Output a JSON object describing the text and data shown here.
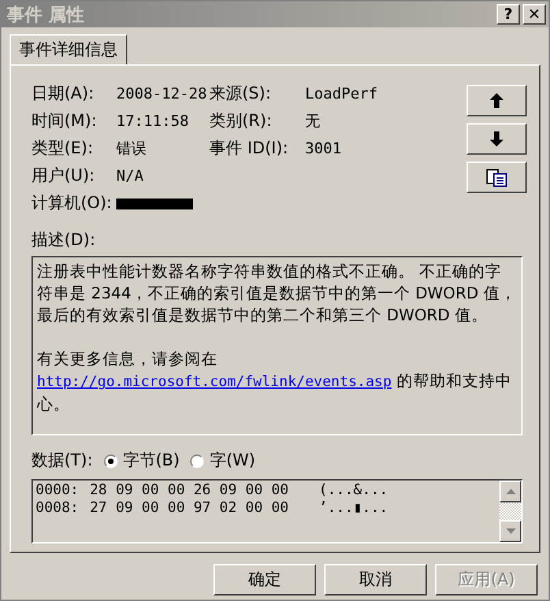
{
  "window": {
    "title": "事件 属性",
    "title_buttons": [
      "?",
      "✕"
    ]
  },
  "tabs": [
    {
      "label": "事件详细信息",
      "selected": true
    }
  ],
  "fields": [
    {
      "label": "日期(A):",
      "value": "2008-12-28",
      "label2": "来源(S):",
      "value2": "LoadPerf"
    },
    {
      "label": "时间(M):",
      "value": "17:11:58",
      "label2": "类别(R):",
      "value2": "无"
    },
    {
      "label": "类型(E):",
      "value": "错误",
      "label2": "事件 ID(I):",
      "value2": "3001"
    },
    {
      "label": "用户(U):",
      "value": "N/A"
    },
    {
      "label": "计算机(O):",
      "kind": "redacted"
    }
  ],
  "side_buttons": [
    {
      "kind": "up"
    },
    {
      "kind": "down"
    },
    {
      "kind": "copy"
    }
  ],
  "description": {
    "label": "描述(D):",
    "text": "注册表中性能计数器名称字符串数值的格式不正确。 不正确的字符串是 2344，不正确的索引值是数据节中的第一个 DWORD 值，最后的有效索引值是数据节中的第二个和第三个 DWORD 值。",
    "more_info": "有关更多信息，请参阅在",
    "link": "http://go.microsoft.com/fwlink/events.asp",
    "link_after": "的帮助和支持中心。"
  },
  "data": {
    "label": "数据(T):",
    "radios": [
      {
        "label": "字节(B)",
        "selected": true
      },
      {
        "label": "字(W)",
        "selected": false
      }
    ],
    "rows": [
      {
        "offset": "0000:",
        "bytes": "28 09 00 00 26 09 00 00",
        "ascii": "(...&..."
      },
      {
        "offset": "0008:",
        "bytes": "27 09 00 00 97 02 00 00",
        "ascii": "’...▮..."
      }
    ]
  },
  "buttons": [
    {
      "label": "确定",
      "disabled": false
    },
    {
      "label": "取消",
      "disabled": false
    },
    {
      "label": "应用(A)",
      "disabled": true
    }
  ]
}
